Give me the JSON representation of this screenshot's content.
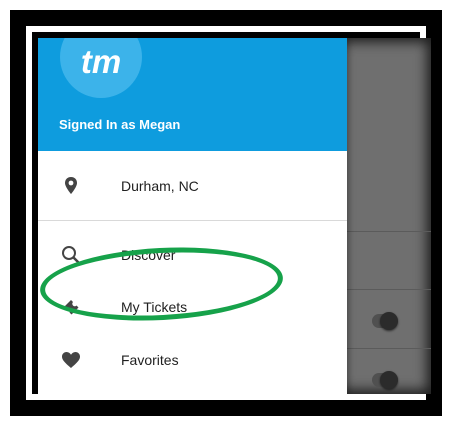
{
  "app": {
    "logo_text": "tm",
    "signed_in_label": "Signed In as Megan"
  },
  "menu": {
    "location": {
      "label": "Durham, NC",
      "icon": "location-pin-icon"
    },
    "items": [
      {
        "label": "Discover",
        "icon": "search-icon"
      },
      {
        "label": "My Tickets",
        "icon": "ticket-icon"
      },
      {
        "label": "Favorites",
        "icon": "heart-icon"
      }
    ]
  },
  "colors": {
    "header": "#0e9cde",
    "highlight_ring": "#16a24a"
  }
}
